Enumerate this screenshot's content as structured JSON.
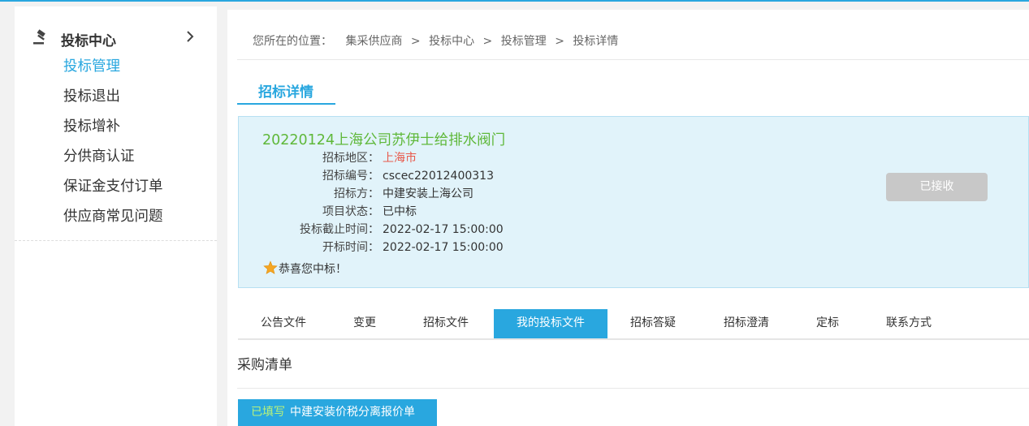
{
  "sidebar": {
    "title": "投标中心",
    "items": [
      {
        "label": "投标管理",
        "active": true
      },
      {
        "label": "投标退出",
        "active": false
      },
      {
        "label": "投标增补",
        "active": false
      },
      {
        "label": "分供商认证",
        "active": false
      },
      {
        "label": "保证金支付订单",
        "active": false
      },
      {
        "label": "供应商常见问题",
        "active": false
      }
    ]
  },
  "breadcrumb": {
    "lead": "您所在的位置：",
    "items": [
      "集采供应商",
      "投标中心",
      "投标管理",
      "投标详情"
    ],
    "separator": ">"
  },
  "section": {
    "title": "招标详情"
  },
  "project": {
    "title": "20220124上海公司苏伊士给排水阀门",
    "fields": [
      {
        "label": "招标地区：",
        "value": "上海市"
      },
      {
        "label": "招标编号：",
        "value": "cscec22012400313"
      },
      {
        "label": "招标方：",
        "value": "中建安装上海公司"
      },
      {
        "label": "项目状态：",
        "value": "已中标"
      },
      {
        "label": "投标截止时间：",
        "value": "2022-02-17 15:00:00"
      },
      {
        "label": "开标时间：",
        "value": "2022-02-17 15:00:00"
      }
    ],
    "congrats": "恭喜您中标！",
    "status_button": "已接收"
  },
  "tabs": [
    {
      "label": "公告文件",
      "active": false
    },
    {
      "label": "变更",
      "active": false
    },
    {
      "label": "招标文件",
      "active": false
    },
    {
      "label": "我的投标文件",
      "active": true
    },
    {
      "label": "招标答疑",
      "active": false
    },
    {
      "label": "招标澄清",
      "active": false
    },
    {
      "label": "定标",
      "active": false
    },
    {
      "label": "联系方式",
      "active": false
    }
  ],
  "purchase_list": {
    "title": "采购清单",
    "button_status": "已填写",
    "button_label": "中建安装价税分离报价单"
  },
  "colors": {
    "accent": "#29a7df",
    "title_green": "#5fb83a",
    "region_red": "#e8584a",
    "info_bg": "#e1f3fa",
    "filled_green": "#b9f27a",
    "disabled_gray": "#c8c8c8"
  },
  "icons": {
    "sidebar_head": "gavel-icon",
    "expand": "chevron-right-icon",
    "congrats": "star-icon"
  }
}
